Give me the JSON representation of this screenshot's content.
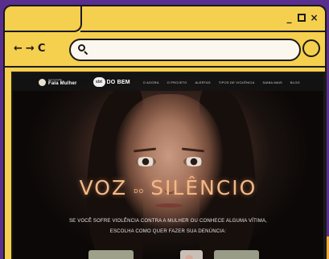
{
  "window": {
    "controls": {
      "minimize": "_",
      "close": "×"
    }
  },
  "navbar": {
    "back": "←",
    "forward": "→",
    "reload": "C",
    "url": ""
  },
  "site": {
    "brand1": {
      "small": "Associação",
      "big": "Fala Mulher"
    },
    "brand2": {
      "logo": "sbt",
      "text": "DO BEM"
    },
    "menu": [
      "O AGORA",
      "O PROJETO",
      "ALERTAS",
      "TIPOS DE VIOLÊNCIA",
      "SAIBA MAIS",
      "BLOG"
    ],
    "title": {
      "part1": "VOZ",
      "part2": "DO",
      "part3": "SILÊNCIO"
    },
    "line1": "SE VOCÊ SOFRE VIOLÊNCIA CONTRA A MULHER OU CONHECE ALGUMA VÍTIMA,",
    "line2": "ESCOLHA COMO QUER FAZER SUA DENÚNCIA:"
  },
  "colors": {
    "frame_yellow": "#f5cf4e",
    "background_purple": "#5a2e8e",
    "title_glow": "#f1b98a"
  }
}
